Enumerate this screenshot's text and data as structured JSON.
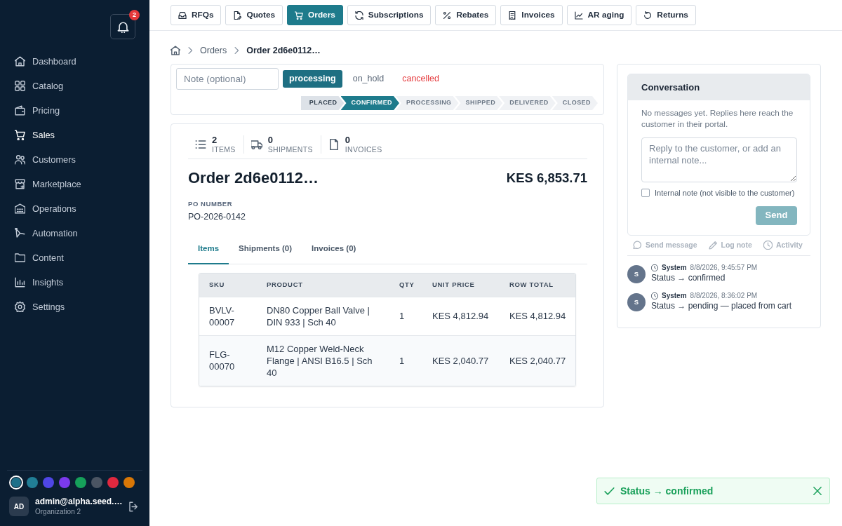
{
  "sidebar": {
    "notification_count": "2",
    "items": [
      {
        "label": "Dashboard",
        "selected": false
      },
      {
        "label": "Catalog",
        "selected": false
      },
      {
        "label": "Pricing",
        "selected": false
      },
      {
        "label": "Sales",
        "selected": true
      },
      {
        "label": "Customers",
        "selected": false
      },
      {
        "label": "Marketplace",
        "selected": false
      },
      {
        "label": "Operations",
        "selected": false
      },
      {
        "label": "Automation",
        "selected": false
      },
      {
        "label": "Content",
        "selected": false
      },
      {
        "label": "Insights",
        "selected": false
      },
      {
        "label": "Settings",
        "selected": false
      }
    ],
    "theme_swatches": [
      {
        "color": "#1f7089",
        "selected": true
      },
      {
        "color": "#217e96",
        "selected": false
      },
      {
        "color": "#4f46e5",
        "selected": false
      },
      {
        "color": "#7c3aed",
        "selected": false
      },
      {
        "color": "#16a05a",
        "selected": false
      },
      {
        "color": "#4b5563",
        "selected": false
      },
      {
        "color": "#e0283f",
        "selected": false
      },
      {
        "color": "#d97706",
        "selected": false
      }
    ],
    "user": {
      "initials": "AD",
      "email": "admin@alpha.seed.…",
      "organization": "Organization 2"
    }
  },
  "top_tabs": [
    {
      "label": "RFQs",
      "selected": false
    },
    {
      "label": "Quotes",
      "selected": false
    },
    {
      "label": "Orders",
      "selected": true
    },
    {
      "label": "Subscriptions",
      "selected": false
    },
    {
      "label": "Rebates",
      "selected": false
    },
    {
      "label": "Invoices",
      "selected": false
    },
    {
      "label": "AR aging",
      "selected": false
    },
    {
      "label": "Returns",
      "selected": false
    }
  ],
  "breadcrumb": [
    {
      "label": "Orders"
    },
    {
      "label": "Order 2d6e0112…"
    }
  ],
  "status_panel": {
    "note_placeholder": "Note (optional)",
    "actions": [
      {
        "label": "processing",
        "kind": "primary"
      },
      {
        "label": "on_hold",
        "kind": "plain"
      },
      {
        "label": "cancelled",
        "kind": "danger"
      }
    ],
    "steps": [
      {
        "label": "PLACED",
        "completed": true,
        "selected": false
      },
      {
        "label": "CONFIRMED",
        "completed": false,
        "selected": true
      },
      {
        "label": "PROCESSING",
        "completed": false,
        "selected": false
      },
      {
        "label": "SHIPPED",
        "completed": false,
        "selected": false
      },
      {
        "label": "DELIVERED",
        "completed": false,
        "selected": false
      },
      {
        "label": "CLOSED",
        "completed": false,
        "selected": false
      }
    ]
  },
  "order": {
    "stats": [
      {
        "value": "2",
        "label": "ITEMS"
      },
      {
        "value": "0",
        "label": "SHIPMENTS"
      },
      {
        "value": "0",
        "label": "INVOICES"
      }
    ],
    "title": "Order 2d6e0112…",
    "total": "KES 6,853.71",
    "po_label": "PO NUMBER",
    "po_number": "PO-2026-0142",
    "tabs": [
      {
        "label": "Items",
        "selected": true
      },
      {
        "label": "Shipments (0)",
        "selected": false
      },
      {
        "label": "Invoices (0)",
        "selected": false
      }
    ],
    "table": {
      "columns": [
        "SKU",
        "PRODUCT",
        "QTY",
        "UNIT PRICE",
        "ROW TOTAL"
      ],
      "rows": [
        [
          "BVLV-00007",
          "DN80 Copper Ball Valve | DIN 933 | Sch 40",
          "1",
          "KES 4,812.94",
          "KES 4,812.94"
        ],
        [
          "FLG-00070",
          "M12 Copper Weld-Neck Flange | ANSI B16.5 | Sch 40",
          "1",
          "KES 2,040.77",
          "KES 2,040.77"
        ]
      ]
    }
  },
  "conversation": {
    "title": "Conversation",
    "empty_text": "No messages yet. Replies here reach the customer in their portal.",
    "reply_placeholder": "Reply to the customer, or add an internal note...",
    "internal_note": {
      "label": "Internal note (not visible to the customer)",
      "checked": false
    },
    "send": {
      "label": "Send",
      "disabled": true
    },
    "actions": [
      {
        "label": "Send message"
      },
      {
        "label": "Log note"
      },
      {
        "label": "Activity"
      }
    ],
    "activity": [
      {
        "initial": "S",
        "author": "System",
        "time": "8/8/2026, 9:45:57 PM",
        "text": "Status → confirmed"
      },
      {
        "initial": "S",
        "author": "System",
        "time": "8/8/2026, 8:36:02 PM",
        "text": "Status → pending — placed from cart"
      }
    ]
  },
  "toast": {
    "text": "Status → confirmed"
  }
}
